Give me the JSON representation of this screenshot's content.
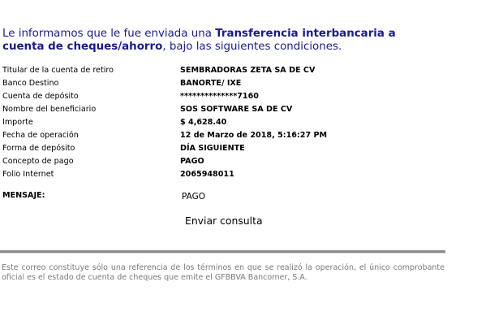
{
  "intro": {
    "part1": "Le informamos que le fue enviada una ",
    "highlight": "Transferencia interbancaria a cuenta de cheques/ahorro",
    "part2": ", bajo las siguientes condiciones."
  },
  "details": [
    {
      "label": "Titular de la cuenta de retiro",
      "value": "SEMBRADORAS ZETA SA DE CV"
    },
    {
      "label": "Banco Destino",
      "value": "BANORTE/ IXE"
    },
    {
      "label": "Cuenta de depósito",
      "value": "**************7160"
    },
    {
      "label": "Nombre del beneficiario",
      "value": "SOS SOFTWARE SA DE CV"
    },
    {
      "label": "Importe",
      "value": "$ 4,628.40"
    },
    {
      "label": "Fecha de operación",
      "value": "12 de Marzo de 2018, 5:16:27 PM"
    },
    {
      "label": "Forma de depósito",
      "value": "DÍA SIGUIENTE"
    },
    {
      "label": "Concepto de pago",
      "value": "PAGO"
    },
    {
      "label": "Folio Internet",
      "value": "2065948011"
    }
  ],
  "message": {
    "label": "MENSAJE:",
    "value": "PAGO"
  },
  "send_link": "Enviar consulta",
  "footer": "Este correo constituye sólo una referencia de los términos en que se realizó la operación, el único comprobante oficial es el estado de cuenta de cheques que emite el GFBBVA Bancomer, S.A."
}
